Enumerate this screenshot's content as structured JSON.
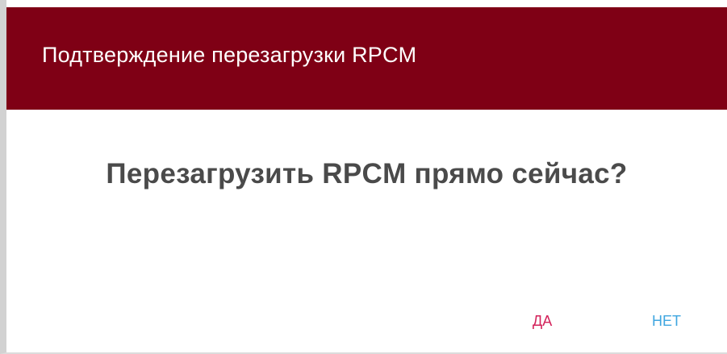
{
  "dialog": {
    "title": "Подтверждение перезагрузки RPCM",
    "message": "Перезагрузить RPCM прямо сейчас?",
    "yes_label": "ДА",
    "no_label": "НЕТ"
  },
  "colors": {
    "titlebar": "#7f0015",
    "title_text": "#ffffff",
    "message_text": "#4a4a4a",
    "yes_button": "#d3225a",
    "no_button": "#3fa6e0"
  }
}
